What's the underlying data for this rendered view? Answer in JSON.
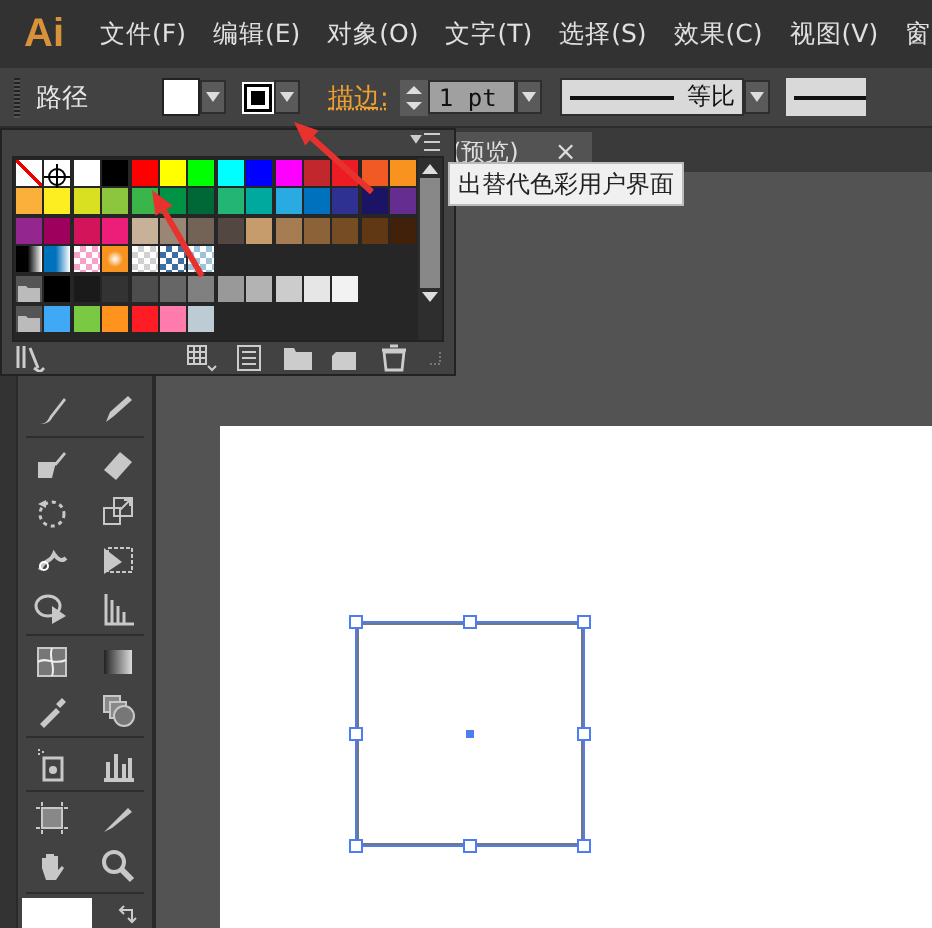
{
  "menu": {
    "logo": "Ai",
    "items": [
      "文件(F)",
      "编辑(E)",
      "对象(O)",
      "文字(T)",
      "选择(S)",
      "效果(C)",
      "视图(V)",
      "窗"
    ]
  },
  "control_bar": {
    "selection": "路径",
    "stroke_label": "描边:",
    "stroke_weight": "1 pt",
    "profile": "等比"
  },
  "document_tab": {
    "title": "(预览)",
    "close": "×"
  },
  "tooltip": "出替代色彩用户界面",
  "swatches": {
    "rows": [
      [
        {
          "kind": "none"
        },
        {
          "kind": "registration"
        },
        {
          "kind": "solid",
          "color": "#ffffff"
        },
        {
          "kind": "solid",
          "color": "#000000"
        },
        {
          "kind": "solid",
          "color": "#ff0000"
        },
        {
          "kind": "solid",
          "color": "#ffff00"
        },
        {
          "kind": "solid",
          "color": "#00ff00"
        },
        {
          "kind": "solid",
          "color": "#00ffff"
        },
        {
          "kind": "solid",
          "color": "#0000ff"
        },
        {
          "kind": "solid",
          "color": "#ff00ff"
        },
        {
          "kind": "solid",
          "color": "#c1272d"
        },
        {
          "kind": "solid",
          "color": "#ed1c24"
        },
        {
          "kind": "solid",
          "color": "#f15a24"
        },
        {
          "kind": "solid",
          "color": "#f7931e"
        }
      ],
      [
        {
          "kind": "solid",
          "color": "#fbb03b"
        },
        {
          "kind": "solid",
          "color": "#fcee21"
        },
        {
          "kind": "solid",
          "color": "#d9e021"
        },
        {
          "kind": "solid",
          "color": "#8cc63f"
        },
        {
          "kind": "solid",
          "color": "#39b54a"
        },
        {
          "kind": "solid",
          "color": "#009245"
        },
        {
          "kind": "solid",
          "color": "#006837"
        },
        {
          "kind": "solid",
          "color": "#22b573"
        },
        {
          "kind": "solid",
          "color": "#00a99d"
        },
        {
          "kind": "solid",
          "color": "#29abe2"
        },
        {
          "kind": "solid",
          "color": "#0071bc"
        },
        {
          "kind": "solid",
          "color": "#2e3192"
        },
        {
          "kind": "solid",
          "color": "#1b1464"
        },
        {
          "kind": "solid",
          "color": "#662d91"
        }
      ],
      [
        {
          "kind": "solid",
          "color": "#93278f"
        },
        {
          "kind": "solid",
          "color": "#9e005d"
        },
        {
          "kind": "solid",
          "color": "#d4145a"
        },
        {
          "kind": "solid",
          "color": "#ed1e79"
        },
        {
          "kind": "solid",
          "color": "#c7b299"
        },
        {
          "kind": "solid",
          "color": "#998675"
        },
        {
          "kind": "solid",
          "color": "#736357"
        },
        {
          "kind": "solid",
          "color": "#534741"
        },
        {
          "kind": "solid",
          "color": "#c69c6d"
        },
        {
          "kind": "solid",
          "color": "#a67c52"
        },
        {
          "kind": "solid",
          "color": "#8c6239"
        },
        {
          "kind": "solid",
          "color": "#754c24"
        },
        {
          "kind": "solid",
          "color": "#603813"
        },
        {
          "kind": "solid",
          "color": "#42210b"
        }
      ],
      [
        {
          "kind": "gradient",
          "color": "#000000"
        },
        {
          "kind": "gradient",
          "color": "#0071bc"
        },
        {
          "kind": "pattern",
          "color": "#f7a0c8"
        },
        {
          "kind": "radial",
          "color": "#f7931e"
        },
        {
          "kind": "pattern",
          "color": "#d0d0d0"
        },
        {
          "kind": "pattern",
          "color": "#3b6ea5"
        },
        {
          "kind": "pattern",
          "color": "#9cc4d8"
        }
      ],
      [
        {
          "kind": "folder"
        },
        {
          "kind": "solid",
          "color": "#000000"
        },
        {
          "kind": "solid",
          "color": "#1a1a1a"
        },
        {
          "kind": "solid",
          "color": "#333333"
        },
        {
          "kind": "solid",
          "color": "#4d4d4d"
        },
        {
          "kind": "solid",
          "color": "#666666"
        },
        {
          "kind": "solid",
          "color": "#808080"
        },
        {
          "kind": "solid",
          "color": "#999999"
        },
        {
          "kind": "solid",
          "color": "#b3b3b3"
        },
        {
          "kind": "solid",
          "color": "#cccccc"
        },
        {
          "kind": "solid",
          "color": "#e6e6e6"
        },
        {
          "kind": "solid",
          "color": "#f2f2f2"
        }
      ],
      [
        {
          "kind": "folder"
        },
        {
          "kind": "solid",
          "color": "#3fa9f5"
        },
        {
          "kind": "solid",
          "color": "#7ac943"
        },
        {
          "kind": "solid",
          "color": "#ff931e"
        },
        {
          "kind": "solid",
          "color": "#ff1d25"
        },
        {
          "kind": "solid",
          "color": "#ff7bac"
        },
        {
          "kind": "solid",
          "color": "#bdccd4"
        }
      ]
    ]
  }
}
